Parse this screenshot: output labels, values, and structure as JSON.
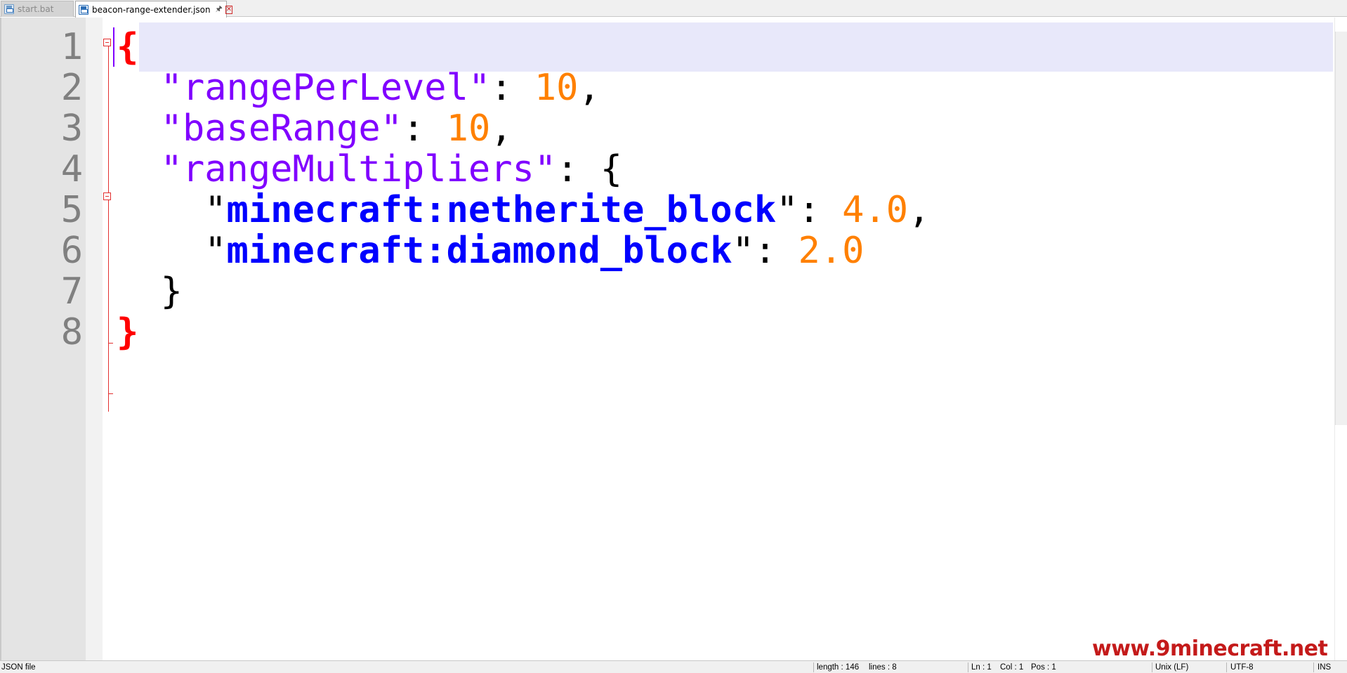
{
  "tabs": [
    {
      "label": "start.bat",
      "active": false
    },
    {
      "label": "beacon-range-extender.json",
      "active": true
    }
  ],
  "editor": {
    "line_numbers": [
      "1",
      "2",
      "3",
      "4",
      "5",
      "6",
      "7",
      "8"
    ],
    "code": {
      "l1_brace": "{",
      "l2_key": "rangePerLevel",
      "l2_value": "10",
      "l3_key": "baseRange",
      "l3_value": "10",
      "l4_key": "rangeMultipliers",
      "l4_brace": "{",
      "l5_key": "minecraft:netherite_block",
      "l5_value": "4.0",
      "l6_key": "minecraft:diamond_block",
      "l6_value": "2.0",
      "l7_brace": "}",
      "l8_brace": "}"
    }
  },
  "statusbar": {
    "file_type": "JSON file",
    "length": "length : 146",
    "lines": "lines : 8",
    "ln": "Ln : 1",
    "col": "Col : 1",
    "pos": "Pos : 1",
    "eol": "Unix (LF)",
    "encoding": "UTF-8",
    "mode": "INS"
  },
  "watermark": "www.9minecraft.net",
  "colors": {
    "key": "#8000ff",
    "key_bold": "#0000ff",
    "number": "#ff8000",
    "root_brace": "#ff0000",
    "fold_marker": "#e23030",
    "current_line": "#e8e8fa"
  }
}
